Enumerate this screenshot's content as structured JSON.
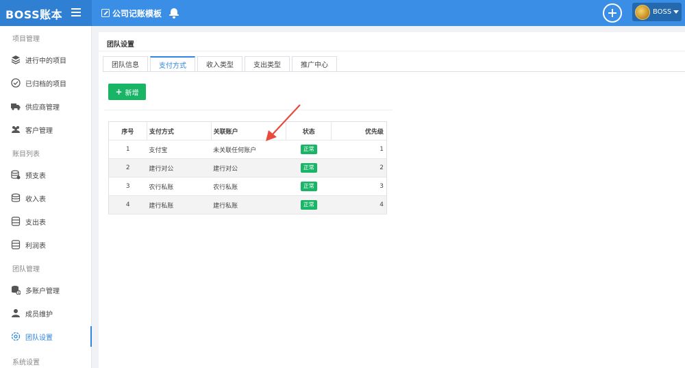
{
  "header": {
    "brand": "BOSS账本",
    "title": "公司记账模板",
    "user": "BOSS"
  },
  "sidebar": {
    "sections": [
      {
        "label": "项目管理",
        "items": [
          {
            "label": "进行中的项目",
            "icon": "layers-icon"
          },
          {
            "label": "已归档的项目",
            "icon": "check-circle-icon"
          },
          {
            "label": "供应商管理",
            "icon": "truck-icon"
          },
          {
            "label": "客户管理",
            "icon": "users-icon"
          }
        ]
      },
      {
        "label": "账目列表",
        "items": [
          {
            "label": "预支表",
            "icon": "database-icon"
          },
          {
            "label": "收入表",
            "icon": "database-icon"
          },
          {
            "label": "支出表",
            "icon": "database-icon"
          },
          {
            "label": "利润表",
            "icon": "database-icon"
          }
        ]
      },
      {
        "label": "团队管理",
        "items": [
          {
            "label": "多账户管理",
            "icon": "database-dollar-icon"
          },
          {
            "label": "成员维护",
            "icon": "user-icon"
          },
          {
            "label": "团队设置",
            "icon": "gear-icon",
            "active": true
          }
        ]
      },
      {
        "label": "系统设置",
        "items": []
      }
    ]
  },
  "panel": {
    "title": "团队设置",
    "tabs": [
      "团队信息",
      "支付方式",
      "收入类型",
      "支出类型",
      "推广中心"
    ],
    "active_tab": "支付方式",
    "add_label": "新增"
  },
  "table": {
    "columns": [
      "序号",
      "支付方式",
      "关联账户",
      "状态",
      "优先级"
    ],
    "rows": [
      {
        "idx": "1",
        "pay": "支付宝",
        "account": "未关联任何账户",
        "status": "正常",
        "priority": "1"
      },
      {
        "idx": "2",
        "pay": "建行对公",
        "account": "建行对公",
        "status": "正常",
        "priority": "2"
      },
      {
        "idx": "3",
        "pay": "农行私账",
        "account": "农行私账",
        "status": "正常",
        "priority": "3"
      },
      {
        "idx": "4",
        "pay": "建行私账",
        "account": "建行私账",
        "status": "正常",
        "priority": "4"
      }
    ]
  },
  "colors": {
    "header": "#3a8ee6",
    "accent": "#2f86e0",
    "success": "#18b566",
    "arrow": "#e84a3c"
  }
}
